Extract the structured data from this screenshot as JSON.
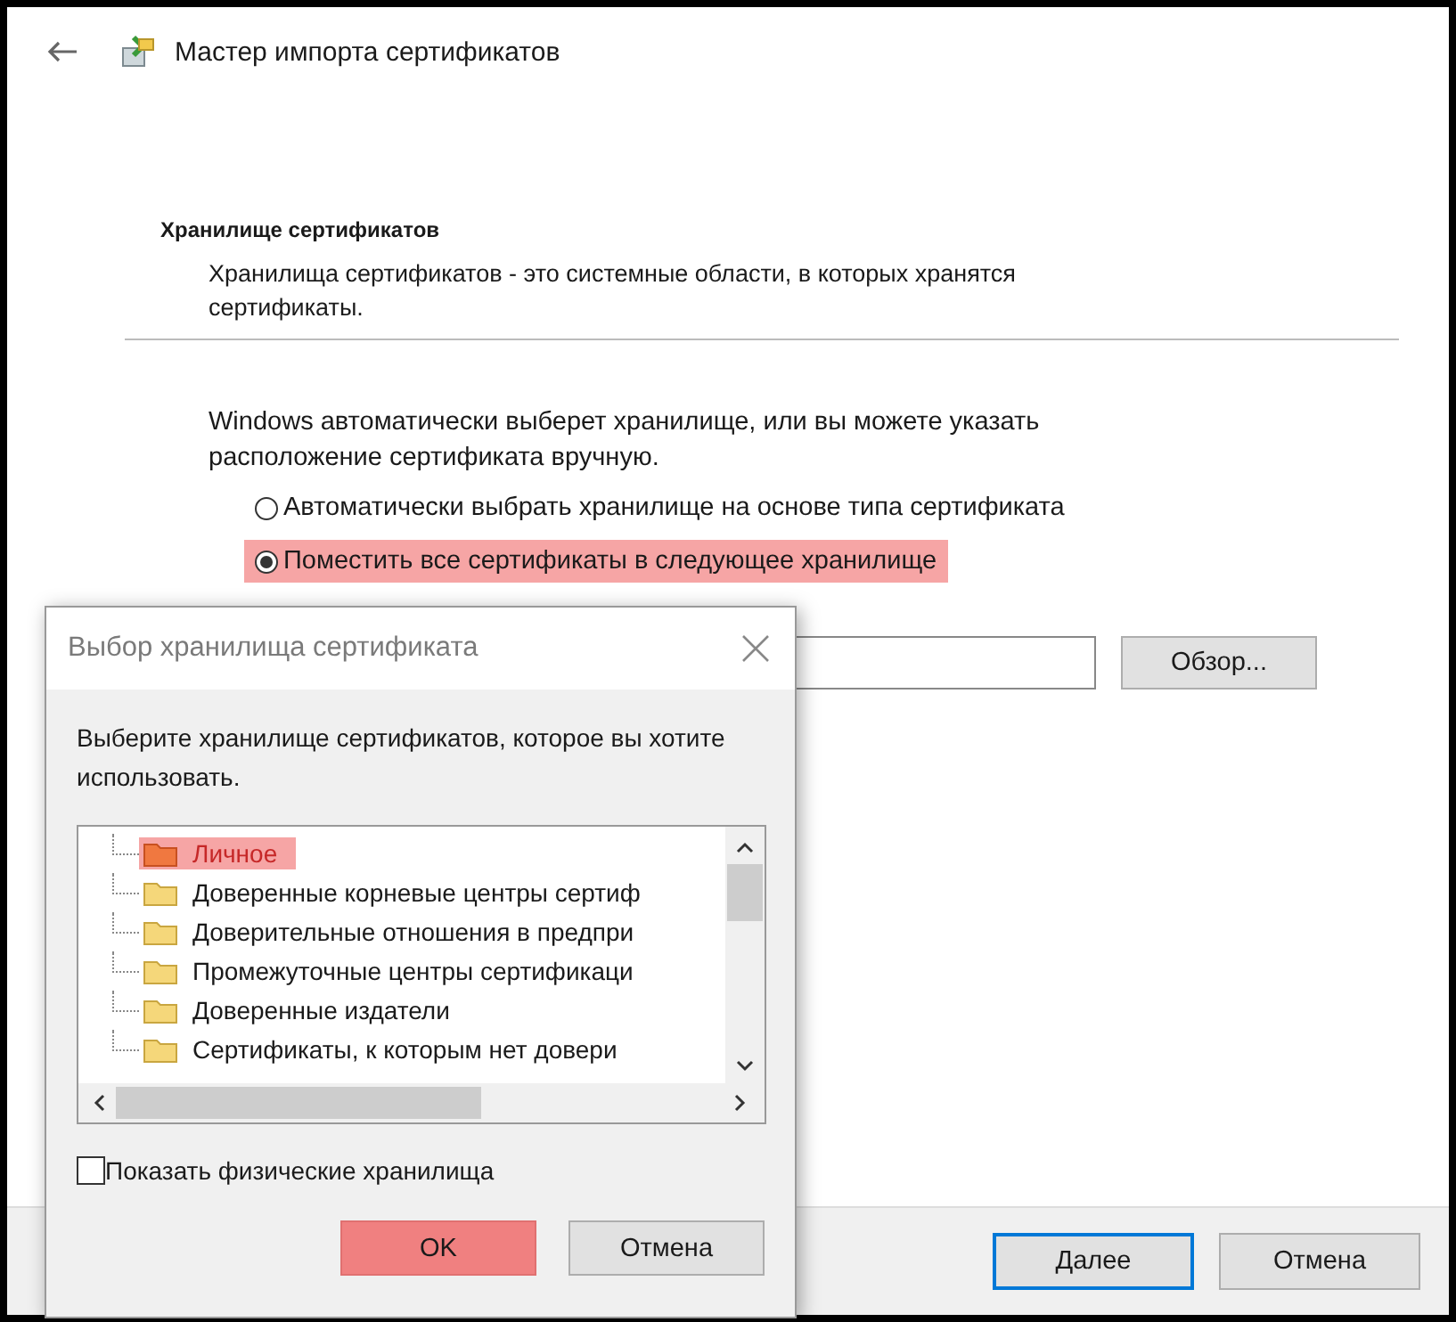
{
  "window": {
    "title": "Мастер импорта сертификатов"
  },
  "page": {
    "heading": "Хранилище сертификатов",
    "description": "Хранилища сертификатов - это системные области, в которых хранятся сертификаты.",
    "intro": "Windows автоматически выберет хранилище, или вы можете указать расположение сертификата вручную.",
    "options": [
      {
        "label": "Автоматически выбрать хранилище на основе типа сертификата",
        "selected": false,
        "highlighted": false
      },
      {
        "label": "Поместить все сертификаты в следующее хранилище",
        "selected": true,
        "highlighted": true
      }
    ],
    "browse_button": "Обзор..."
  },
  "footer_buttons": [
    {
      "label": "Далее",
      "focused": true
    },
    {
      "label": "Отмена",
      "focused": false
    }
  ],
  "dialog": {
    "title": "Выбор хранилища сертификата",
    "prompt": "Выберите хранилище сертификатов, которое вы хотите использовать.",
    "stores": [
      {
        "label": "Личное",
        "selected": true
      },
      {
        "label": "Доверенные корневые центры сертиф",
        "selected": false
      },
      {
        "label": "Доверительные отношения в предпри",
        "selected": false
      },
      {
        "label": "Промежуточные центры сертификаци",
        "selected": false
      },
      {
        "label": "Доверенные издатели",
        "selected": false
      },
      {
        "label": "Сертификаты, к которым нет довери",
        "selected": false
      }
    ],
    "show_physical": {
      "label": "Показать физические хранилища",
      "checked": false
    },
    "buttons": [
      {
        "label": "OK",
        "highlighted": true
      },
      {
        "label": "Отмена",
        "highlighted": false
      }
    ]
  }
}
